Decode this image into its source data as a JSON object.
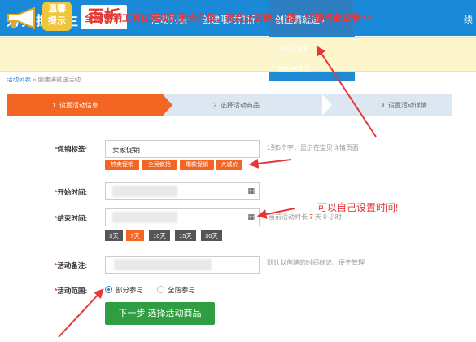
{
  "header": {
    "logo_text": "为打折而生!",
    "logo_badge": "百折",
    "nav": [
      {
        "label": "活动列表"
      },
      {
        "label": "创建限时打折"
      },
      {
        "label": "创建满就送"
      }
    ],
    "nav_overflow": "续"
  },
  "dropdown": {
    "items": [
      "满减 / 包邮",
      "满就送礼品"
    ]
  },
  "banner": {
    "tag_line1": "温馨",
    "tag_line2": "提示",
    "text": "全网营销工具优惠规则重大升级，请点此查看 … 损，详情点此查看>>"
  },
  "breadcrumb": {
    "root": "活动列表",
    "sep": "»",
    "current": "创建满就送活动"
  },
  "steps": [
    {
      "label": "1. 设置活动信息"
    },
    {
      "label": "2. 选择活动商品"
    },
    {
      "label": "3. 设置活动详情"
    }
  ],
  "form": {
    "tag": {
      "label": "促销标签:",
      "value": "卖家促销",
      "hint": "1到5个字，显示在宝贝详情页面",
      "chips": [
        "热卖促销",
        "全民疯抢",
        "爆款促销",
        "大减价"
      ]
    },
    "start": {
      "label": "开始时间:"
    },
    "end": {
      "label": "结束时间:",
      "hint_prefix": "当前活动时长",
      "hint_value": "7",
      "hint_suffix": "天 0 小时"
    },
    "durations": [
      "3天",
      "7天",
      "10天",
      "15天",
      "30天"
    ],
    "note": {
      "label": "活动备注:",
      "hint": "默认以创建的时间标记，便于管理"
    },
    "scope": {
      "label": "活动范围:",
      "options": [
        "部分参与",
        "全店参与"
      ]
    },
    "next_button": "下一步 选择活动商品"
  },
  "annotation": "可以自己设置时间!",
  "colors": {
    "nav_bg": "#1a8ad8",
    "accent_orange": "#f26522",
    "button_green": "#2f9e42",
    "annotation_red": "#e4393c"
  }
}
